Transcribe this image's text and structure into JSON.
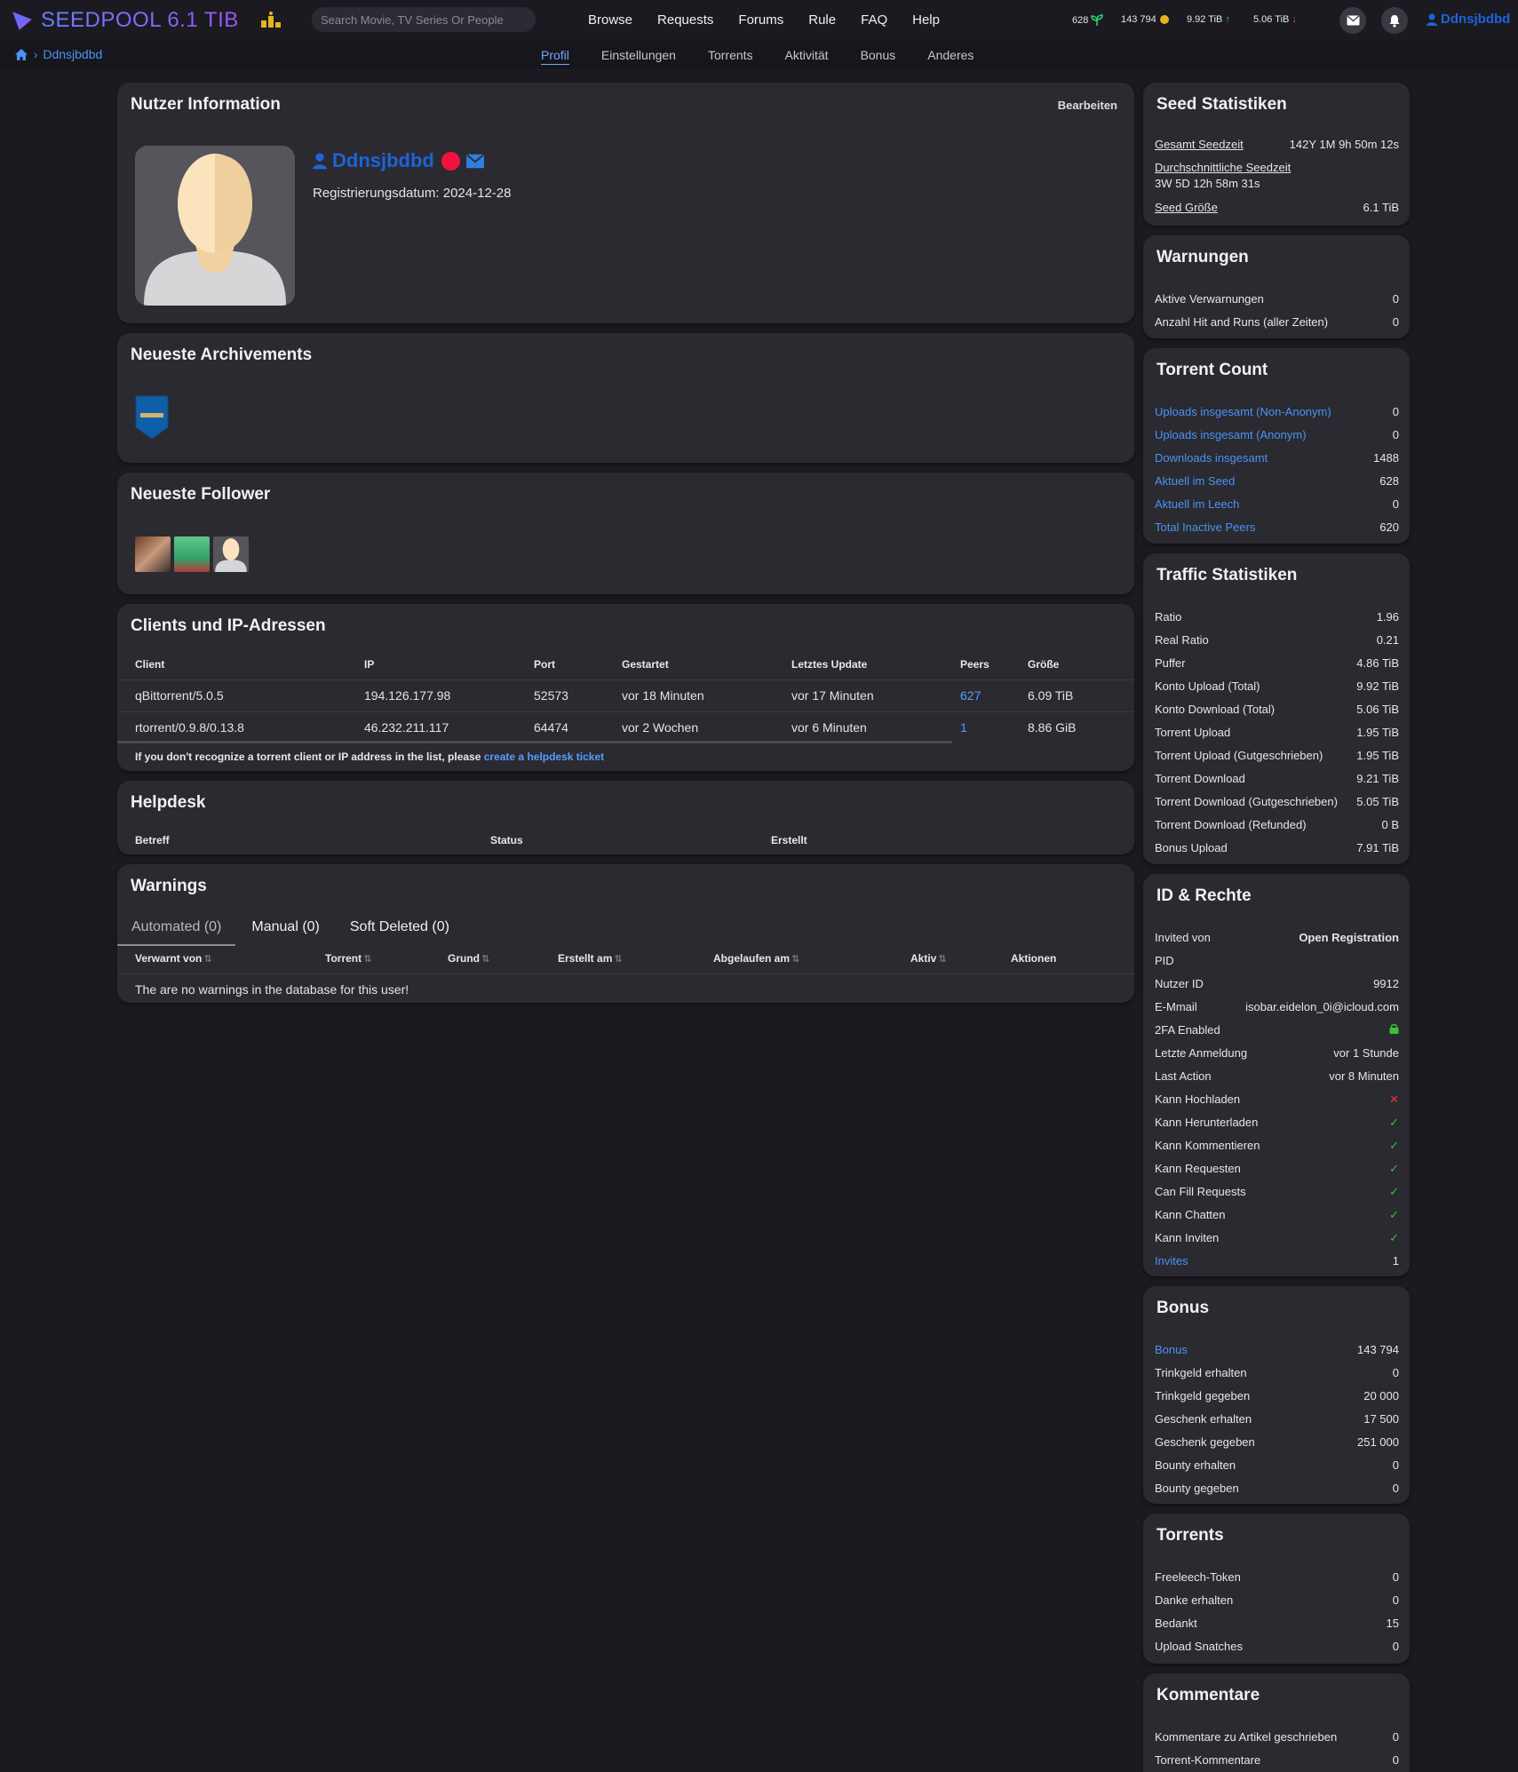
{
  "brand": {
    "name": "SEEDPOOL 6.1 TIB"
  },
  "search": {
    "placeholder": "Search Movie, TV Series Or People"
  },
  "nav": [
    "Browse",
    "Requests",
    "Forums",
    "Rule",
    "FAQ",
    "Help"
  ],
  "stats": {
    "seeding": "628",
    "bonus": "143 794",
    "upload": "9.92 TiB",
    "download": "5.06 TiB"
  },
  "user": {
    "name": "Ddnsjbdbd",
    "registered": "Registrierungsdatum: 2024-12-28"
  },
  "breadcrumb": {
    "current": "Ddnsjbdbd"
  },
  "tabs": [
    "Profil",
    "Einstellungen",
    "Torrents",
    "Aktivität",
    "Bonus",
    "Anderes"
  ],
  "info": {
    "title": "Nutzer Information",
    "edit": "Bearbeiten"
  },
  "achievements": {
    "title": "Neueste Archivements"
  },
  "followers": {
    "title": "Neueste Follower"
  },
  "clients": {
    "title": "Clients und IP-Adressen",
    "headers": [
      "Client",
      "IP",
      "Port",
      "Gestartet",
      "Letztes Update",
      "Peers",
      "Größe"
    ],
    "rows": [
      [
        "qBittorrent/5.0.5",
        "194.126.177.98",
        "52573",
        "vor 18 Minuten",
        "vor 17 Minuten",
        "627",
        "6.09 TiB"
      ],
      [
        "rtorrent/0.9.8/0.13.8",
        "46.232.211.117",
        "64474",
        "vor 2 Wochen",
        "vor 6 Minuten",
        "1",
        "8.86 GiB"
      ]
    ],
    "note": "If you don't recognize a torrent client or IP address in the list, please",
    "note_link": "create a helpdesk ticket"
  },
  "helpdesk": {
    "title": "Helpdesk",
    "headers": [
      "Betreff",
      "Status",
      "Erstellt"
    ]
  },
  "warnings": {
    "title": "Warnings",
    "tabs": [
      "Automated (0)",
      "Manual (0)",
      "Soft Deleted (0)"
    ],
    "headers": [
      "Verwarnt von",
      "Torrent",
      "Grund",
      "Erstellt am",
      "Abgelaufen am",
      "Aktiv",
      "Aktionen"
    ],
    "empty": "The are no warnings in the database for this user!"
  },
  "seed": {
    "title": "Seed Statistiken",
    "total_label": "Gesamt Seedzeit",
    "total": "142Y 1M 9h 50m 12s",
    "avg_label": "Durchschnittliche Seedzeit",
    "avg": "3W 5D 12h 58m 31s",
    "size_label": "Seed Größe",
    "size": "6.1 TiB"
  },
  "warn_stats": {
    "title": "Warnungen",
    "rows": [
      [
        "Aktive Verwarnungen",
        "0"
      ],
      [
        "Anzahl Hit and Runs (aller Zeiten)",
        "0"
      ]
    ]
  },
  "torrent_count": {
    "title": "Torrent Count",
    "rows": [
      [
        "Uploads insgesamt (Non-Anonym)",
        "0"
      ],
      [
        "Uploads insgesamt (Anonym)",
        "0"
      ],
      [
        "Downloads insgesamt",
        "1488"
      ],
      [
        "Aktuell im Seed",
        "628"
      ],
      [
        "Aktuell im Leech",
        "0"
      ],
      [
        "Total Inactive Peers",
        "620"
      ]
    ]
  },
  "traffic": {
    "title": "Traffic Statistiken",
    "rows": [
      [
        "Ratio",
        "1.96"
      ],
      [
        "Real Ratio",
        "0.21"
      ],
      [
        "Puffer",
        "4.86 TiB"
      ],
      [
        "Konto Upload (Total)",
        "9.92 TiB"
      ],
      [
        "Konto Download (Total)",
        "5.06 TiB"
      ],
      [
        "Torrent Upload",
        "1.95 TiB"
      ],
      [
        "Torrent Upload (Gutgeschrieben)",
        "1.95 TiB"
      ],
      [
        "Torrent Download",
        "9.21 TiB"
      ],
      [
        "Torrent Download (Gutgeschrieben)",
        "5.05 TiB"
      ],
      [
        "Torrent Download (Refunded)",
        "0 B"
      ],
      [
        "Bonus Upload",
        "7.91 TiB"
      ]
    ]
  },
  "idrights": {
    "title": "ID & Rechte",
    "rows": [
      [
        "Invited von",
        "Open Registration"
      ],
      [
        "PID",
        ""
      ],
      [
        "Nutzer ID",
        "9912"
      ],
      [
        "E-Mmail",
        "isobar.eidelon_0i@icloud.com"
      ],
      [
        "2FA Enabled",
        "lock"
      ],
      [
        "Letzte Anmeldung",
        "vor 1 Stunde"
      ],
      [
        "Last Action",
        "vor 8 Minuten"
      ],
      [
        "Kann Hochladen",
        "no"
      ],
      [
        "Kann Herunterladen",
        "yes"
      ],
      [
        "Kann Kommentieren",
        "yes"
      ],
      [
        "Kann Requesten",
        "yes"
      ],
      [
        "Can Fill Requests",
        "yes"
      ],
      [
        "Kann Chatten",
        "yes"
      ],
      [
        "Kann Inviten",
        "yes"
      ],
      [
        "Invites",
        "1"
      ]
    ]
  },
  "bonus": {
    "title": "Bonus",
    "rows": [
      [
        "Bonus",
        "143 794"
      ],
      [
        "Trinkgeld erhalten",
        "0"
      ],
      [
        "Trinkgeld gegeben",
        "20 000"
      ],
      [
        "Geschenk erhalten",
        "17 500"
      ],
      [
        "Geschenk gegeben",
        "251 000"
      ],
      [
        "Bounty erhalten",
        "0"
      ],
      [
        "Bounty gegeben",
        "0"
      ]
    ]
  },
  "torrents_box": {
    "title": "Torrents",
    "rows": [
      [
        "Freeleech-Token",
        "0"
      ],
      [
        "Danke erhalten",
        "0"
      ],
      [
        "Bedankt",
        "15"
      ],
      [
        "Upload Snatches",
        "0"
      ]
    ]
  },
  "comments": {
    "title": "Kommentare",
    "rows": [
      [
        "Kommentare zu Artikel geschrieben",
        "0"
      ],
      [
        "Torrent-Kommentare",
        "0"
      ]
    ]
  },
  "colors": {
    "accent": "#1d64d8",
    "link": "#4b93f5",
    "panel": "#2a2a30",
    "bg": "#1b1a21",
    "ok": "#3fbf3f",
    "bad": "#e03a3a"
  }
}
